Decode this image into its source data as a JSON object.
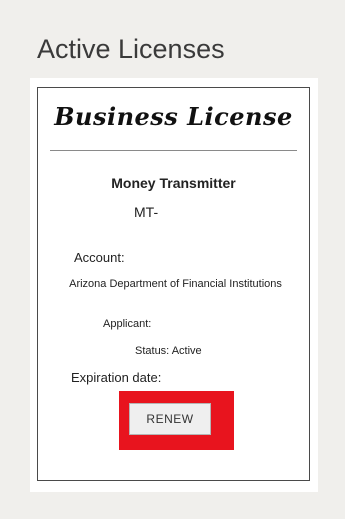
{
  "page": {
    "title": "Active Licenses"
  },
  "license_card": {
    "heading": "Business License",
    "license_type": "Money Transmitter",
    "license_number": "MT-",
    "account_label": "Account:",
    "account_value": "Arizona Department of Financial Institutions",
    "applicant_label": "Applicant:",
    "status_text": "Status: Active",
    "expiration_label": "Expiration date:",
    "renew_label": "RENEW"
  },
  "colors": {
    "highlight": "#e8141e",
    "background": "#f0efec",
    "card_border": "#4a4a4a"
  }
}
